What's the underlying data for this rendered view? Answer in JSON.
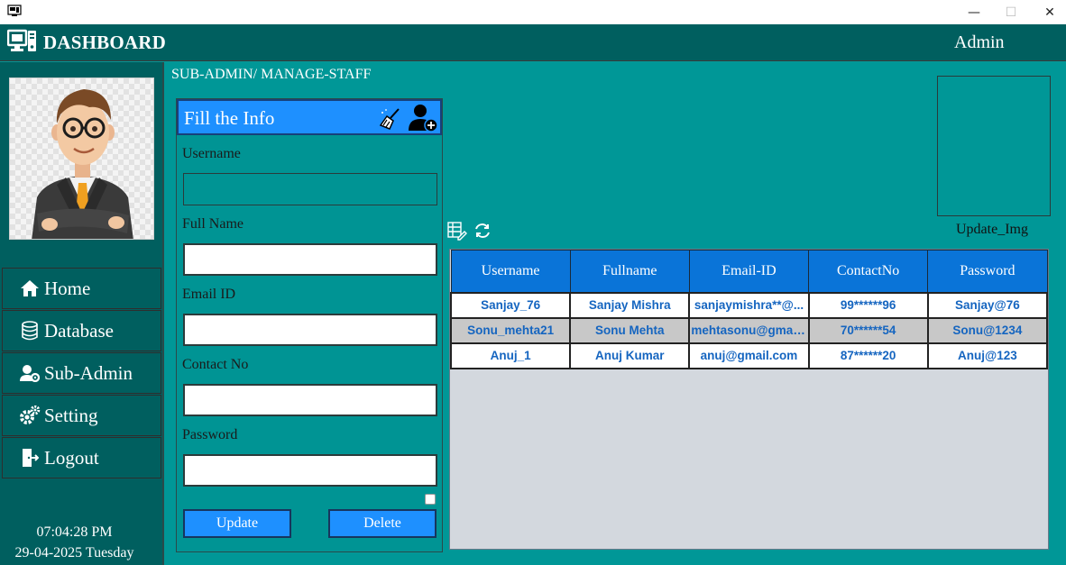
{
  "window": {
    "minimize_glyph": "—",
    "maximize_glyph": "☐",
    "close_glyph": "✕"
  },
  "header": {
    "title": "DASHBOARD",
    "user": "Admin"
  },
  "sidebar": {
    "items": [
      {
        "label": "Home",
        "icon": "home-icon"
      },
      {
        "label": "Database",
        "icon": "database-icon"
      },
      {
        "label": "Sub-Admin",
        "icon": "user-gear-icon"
      },
      {
        "label": "Setting",
        "icon": "gears-icon"
      },
      {
        "label": "Logout",
        "icon": "logout-icon"
      }
    ],
    "time": "07:04:28 PM",
    "date": "29-04-2025 Tuesday"
  },
  "breadcrumb": "SUB-ADMIN/ MANAGE-STAFF",
  "form": {
    "title": "Fill the Info",
    "fields": [
      {
        "label": "Username",
        "value": ""
      },
      {
        "label": "Full Name",
        "value": ""
      },
      {
        "label": "Email ID",
        "value": ""
      },
      {
        "label": "Contact No",
        "value": ""
      },
      {
        "label": "Password",
        "value": ""
      }
    ],
    "update_label": "Update",
    "delete_label": "Delete"
  },
  "image_panel": {
    "update_label": "Update_Img"
  },
  "table": {
    "columns": [
      "Username",
      "Fullname",
      "Email-ID",
      "ContactNo",
      "Password"
    ],
    "rows": [
      [
        "Sanjay_76",
        "Sanjay Mishra",
        "sanjaymishra**@...",
        "99******96",
        "Sanjay@76"
      ],
      [
        "Sonu_mehta21",
        "Sonu Mehta",
        "mehtasonu@gmail...",
        "70******54",
        "Sonu@1234"
      ],
      [
        "Anuj_1",
        "Anuj Kumar",
        "anuj@gmail.com",
        "87******20",
        "Anuj@123"
      ]
    ]
  },
  "colors": {
    "header_bg": "#005f5f",
    "content_bg": "#009797",
    "accent_blue": "#1e90ff",
    "table_header": "#0a74d8",
    "cell_text": "#1565c0"
  }
}
